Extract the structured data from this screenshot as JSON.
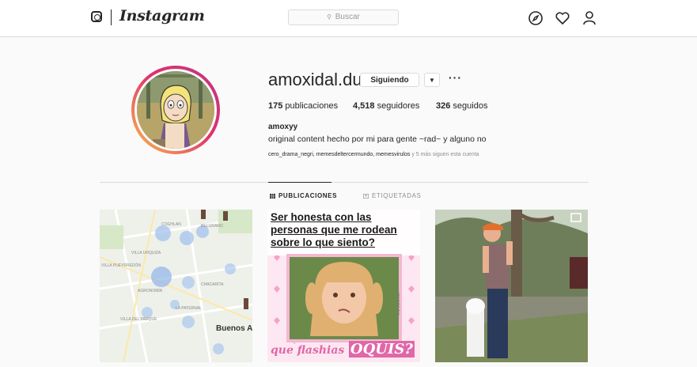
{
  "nav": {
    "brand": "Instagram",
    "search_placeholder": "Buscar",
    "icons": [
      "instagram-glyph-icon",
      "compass-icon",
      "heart-icon",
      "profile-icon"
    ]
  },
  "profile": {
    "username": "amoxidal.duo",
    "follow_state_label": "Siguiendo",
    "stats": [
      {
        "count": "175",
        "label": "publicaciones"
      },
      {
        "count": "4,518",
        "label": "seguidores"
      },
      {
        "count": "326",
        "label": "seguidos"
      }
    ],
    "full_name": "amoxyy",
    "bio": "original content hecho por mi para gente ~rad~ y alguno no",
    "followed_by": {
      "accounts": "cero_drama_negri, memesdeltercermundo, memesvirulos",
      "more": "y 5 más siguen esta cuenta"
    }
  },
  "tabs": [
    {
      "label": "PUBLICACIONES",
      "active": true
    },
    {
      "label": "ETIQUETADAS",
      "active": false
    }
  ],
  "posts": {
    "map": {
      "labels": {
        "a": "COGHLAN",
        "b": "BELGRANO",
        "c": "VILLA URQUIZA",
        "d": "VILLA PUEYRREDÓN",
        "e": "AGRONOMÍA",
        "f": "CHACARITA",
        "g": "LA PATERNAL",
        "h": "VILLA DEL PARQUE",
        "city": "Buenos Ai"
      }
    },
    "meme": {
      "caption_top": "Ser honesta con las personas que me rodean sobre lo que siento?",
      "caption_bottom": "que flashias",
      "caption_bottom_big": "OQUIS?",
      "watermark": "amoxidal.duo"
    }
  },
  "colors": {
    "accent_border": "#dbdbdb",
    "text": "#262626",
    "muted": "#8e8e8e",
    "meme_pink": "#f5a3c7"
  }
}
